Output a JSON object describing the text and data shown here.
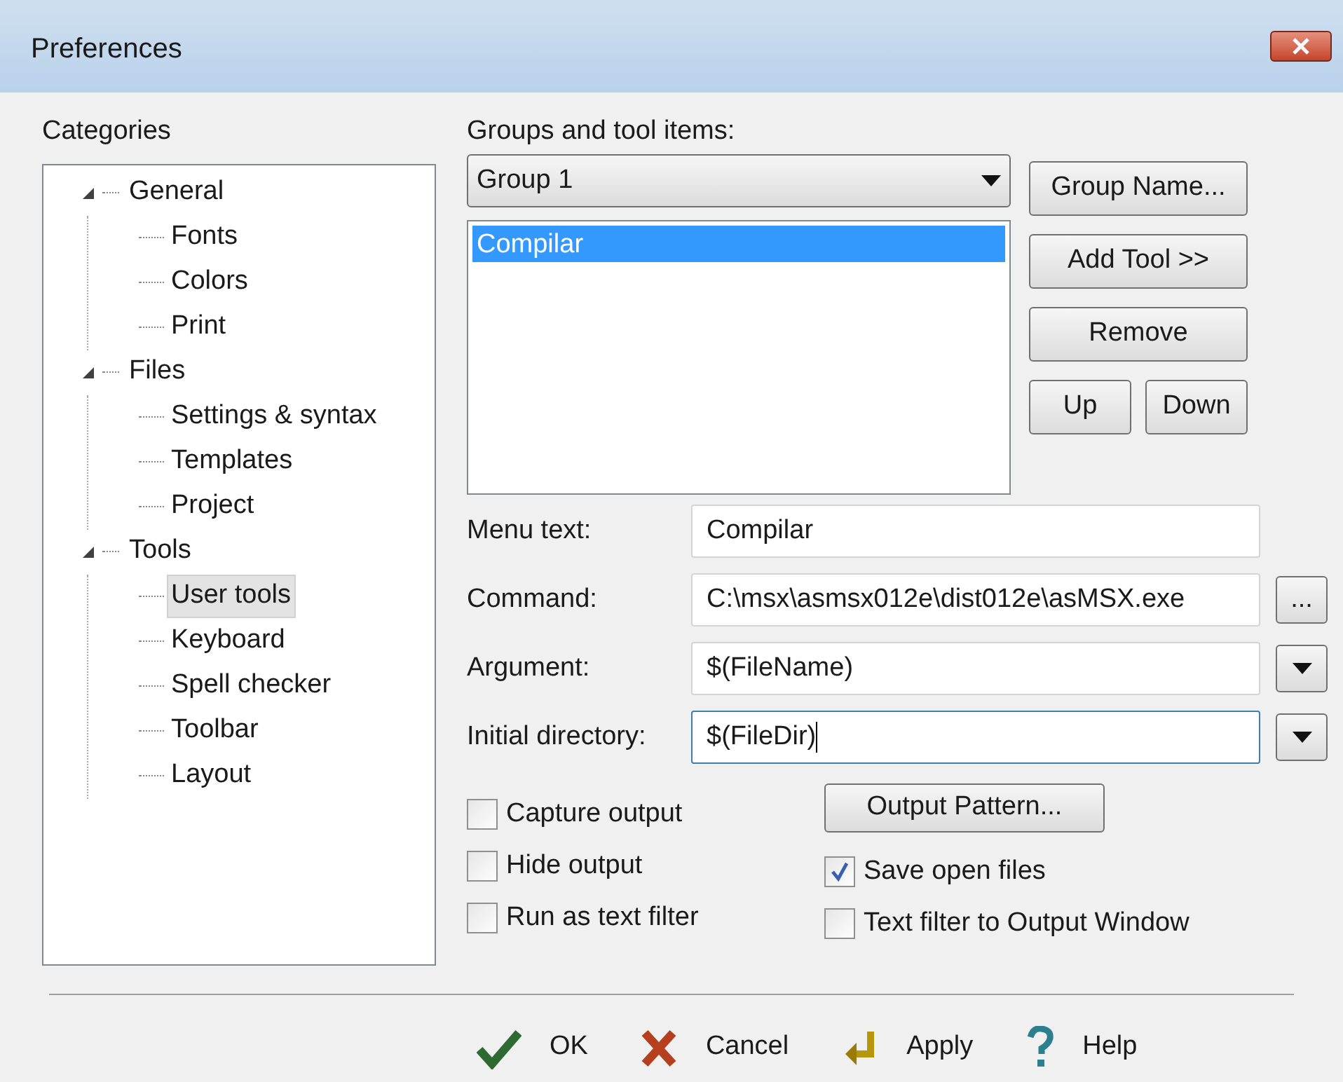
{
  "window": {
    "title": "Preferences"
  },
  "categories": {
    "label": "Categories",
    "items": [
      {
        "label": "General",
        "expanded": true,
        "selected": false,
        "children": [
          {
            "label": "Fonts",
            "selected": false
          },
          {
            "label": "Colors",
            "selected": false
          },
          {
            "label": "Print",
            "selected": false
          }
        ]
      },
      {
        "label": "Files",
        "expanded": true,
        "selected": false,
        "children": [
          {
            "label": "Settings & syntax",
            "selected": false
          },
          {
            "label": "Templates",
            "selected": false
          },
          {
            "label": "Project",
            "selected": false
          }
        ]
      },
      {
        "label": "Tools",
        "expanded": true,
        "selected": false,
        "children": [
          {
            "label": "User tools",
            "selected": true
          },
          {
            "label": "Keyboard",
            "selected": false
          },
          {
            "label": "Spell checker",
            "selected": false
          },
          {
            "label": "Toolbar",
            "selected": false
          },
          {
            "label": "Layout",
            "selected": false
          }
        ]
      }
    ]
  },
  "groups": {
    "label": "Groups and tool items:",
    "dropdown": "Group 1",
    "items": [
      {
        "label": "Compilar",
        "selected": true
      }
    ],
    "buttons": [
      "Group Name...",
      "Add Tool >>",
      "Remove"
    ],
    "up": "Up",
    "down": "Down"
  },
  "fields": [
    {
      "label": "Menu text:",
      "value": "Compilar",
      "kind": "plain",
      "focused": false
    },
    {
      "label": "Command:",
      "value": "C:\\msx\\asmsx012e\\dist012e\\asMSX.exe",
      "kind": "browse",
      "button": "...",
      "focused": false
    },
    {
      "label": "Argument:",
      "value": "$(FileName)",
      "kind": "menu",
      "focused": false
    },
    {
      "label": "Initial directory:",
      "value": "$(FileDir)",
      "kind": "menu",
      "focused": true
    }
  ],
  "options": {
    "left": [
      {
        "label": "Capture output",
        "checked": false
      },
      {
        "label": "Hide output",
        "checked": false
      },
      {
        "label": "Run as text filter",
        "checked": false
      }
    ],
    "pattern_button": "Output Pattern...",
    "right": [
      {
        "label": "Save open files",
        "checked": true
      },
      {
        "label": "Text filter to Output Window",
        "checked": false
      }
    ]
  },
  "footer": [
    {
      "label": "OK",
      "kind": "ok"
    },
    {
      "label": "Cancel",
      "kind": "cancel"
    },
    {
      "label": "Apply",
      "kind": "apply"
    },
    {
      "label": "Help",
      "kind": "help"
    }
  ]
}
